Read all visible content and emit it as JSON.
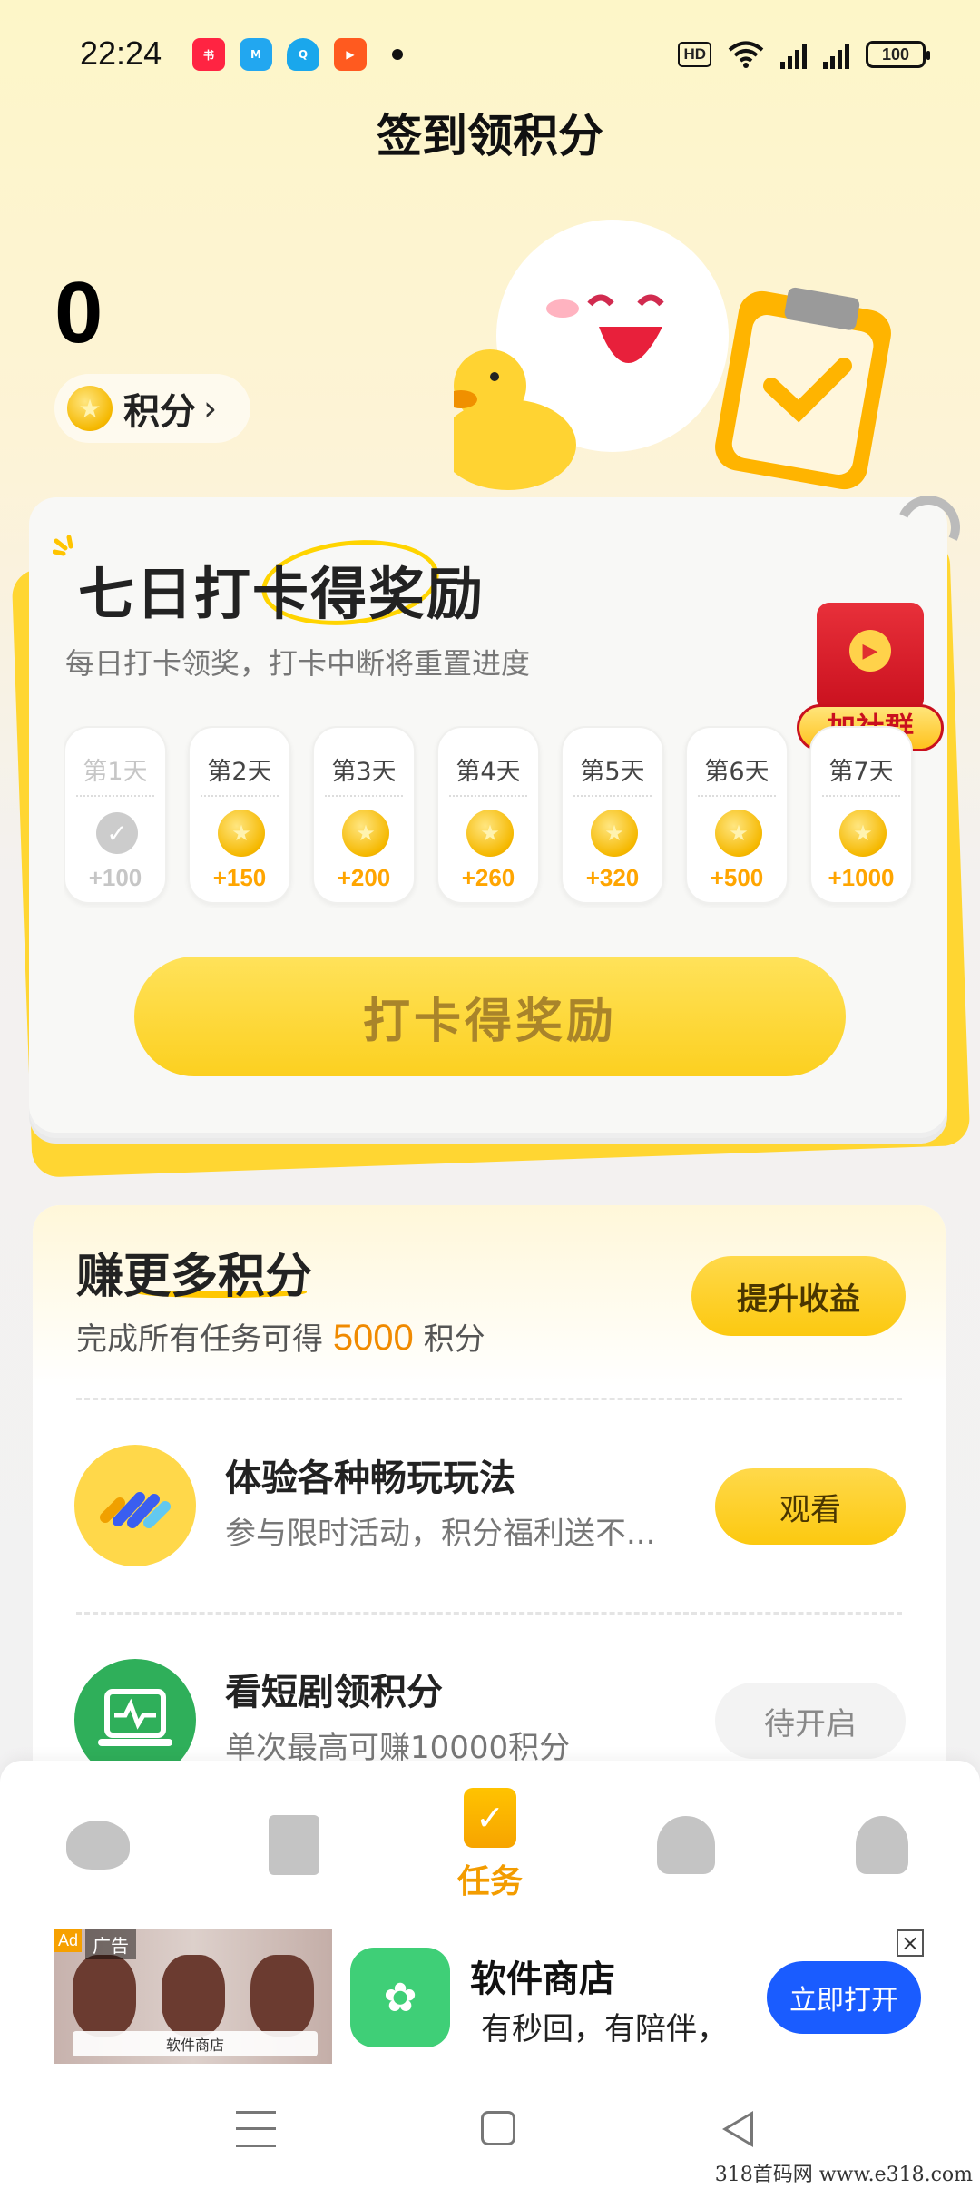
{
  "status_bar": {
    "time": "22:24",
    "app_icons": [
      "xiaohongshu-icon",
      "mi-icon",
      "qq-icon",
      "video-icon"
    ],
    "hd": "HD",
    "network": "5G",
    "battery": "100"
  },
  "page": {
    "title": "签到领积分"
  },
  "points": {
    "value": "0",
    "label": "积分",
    "coin_glyph": "★"
  },
  "checkin": {
    "title": "七日打卡得奖励",
    "subtitle": "每日打卡领奖，打卡中断将重置进度",
    "group_label": "加社群",
    "button_label": "打卡得奖励",
    "days": [
      {
        "label": "第1天",
        "reward": "+100",
        "done": true
      },
      {
        "label": "第2天",
        "reward": "+150",
        "done": false
      },
      {
        "label": "第3天",
        "reward": "+200",
        "done": false
      },
      {
        "label": "第4天",
        "reward": "+260",
        "done": false
      },
      {
        "label": "第5天",
        "reward": "+320",
        "done": false
      },
      {
        "label": "第6天",
        "reward": "+500",
        "done": false
      },
      {
        "label": "第7天",
        "reward": "+1000",
        "done": false
      }
    ]
  },
  "earn": {
    "title": "赚更多积分",
    "desc_prefix": "完成所有任务可得",
    "desc_amount": "5000",
    "desc_suffix": "积分",
    "boost_label": "提升收益",
    "tasks": [
      {
        "title": "体验各种畅玩玩法",
        "subtitle": "参与限时活动，积分福利送不...",
        "button": "观看",
        "icon": "play-modes-icon"
      },
      {
        "title": "看短剧领积分",
        "subtitle": "单次最高可赚10000积分",
        "button": "待开启",
        "icon": "tv-icon"
      }
    ]
  },
  "bottom_nav": {
    "items": [
      {
        "icon": "cloud-play-icon",
        "label": ""
      },
      {
        "icon": "wallet-icon",
        "label": ""
      },
      {
        "icon": "clipboard-check-icon",
        "label": "任务",
        "active": true
      },
      {
        "icon": "friends-icon",
        "label": ""
      },
      {
        "icon": "profile-icon",
        "label": ""
      }
    ]
  },
  "ad": {
    "badge": "广告",
    "ad_mark": "Ad",
    "image_search_text": "软件商店",
    "app_name": "软件商店",
    "description": "有秒回，有陪伴，",
    "open_button": "立即打开",
    "close_glyph": "×"
  },
  "watermark": "318首码网 www.e318.com",
  "colors": {
    "accent_yellow": "#fcd020",
    "accent_orange": "#f39c00",
    "ad_blue": "#1a5cff"
  }
}
